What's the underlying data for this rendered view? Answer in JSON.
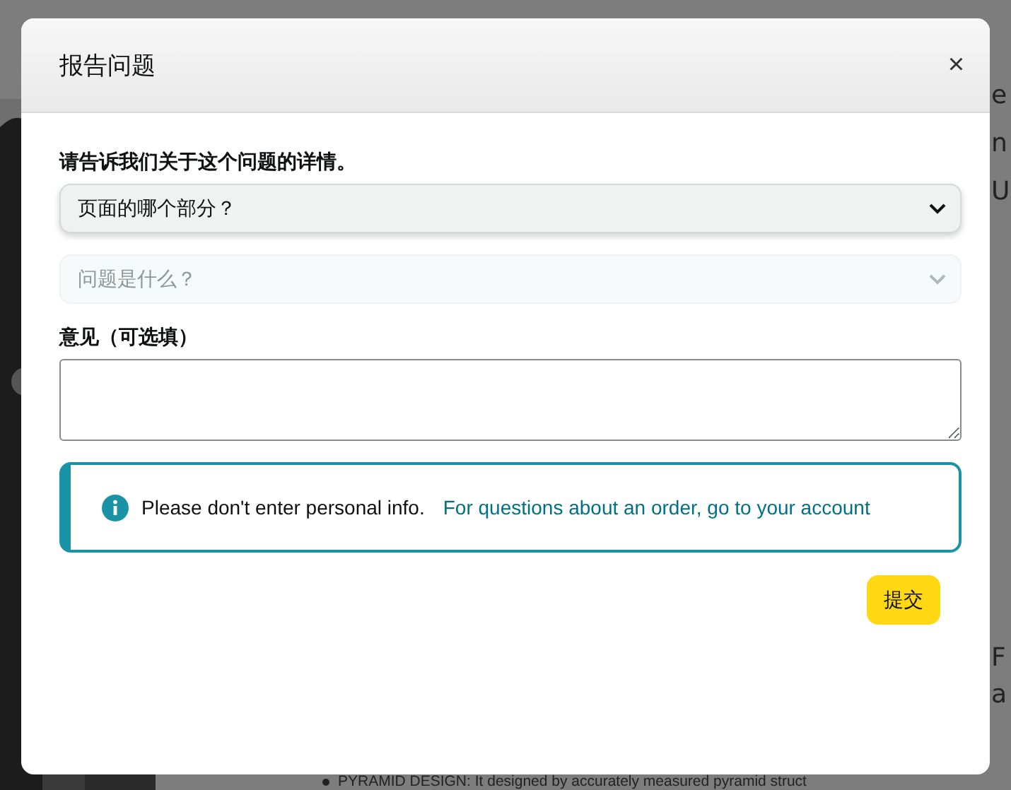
{
  "background_page": {
    "edge_letters": [
      "e",
      "n",
      "U",
      "F",
      "a"
    ],
    "bullet": "PYRAMID DESIGN: It designed by accurately measured pyramid struct"
  },
  "dialog": {
    "title": "报告问题",
    "close": "×",
    "prompt": "请告诉我们关于这个问题的详情。",
    "selects": [
      {
        "placeholder": "页面的哪个部分？",
        "disabled": false
      },
      {
        "placeholder": "问题是什么？",
        "disabled": true
      }
    ],
    "comment_label": "意见（可选填）",
    "notice": {
      "text": "Please don't enter personal info.",
      "link": "For questions about an order, go to your account"
    },
    "submit": "提交"
  }
}
